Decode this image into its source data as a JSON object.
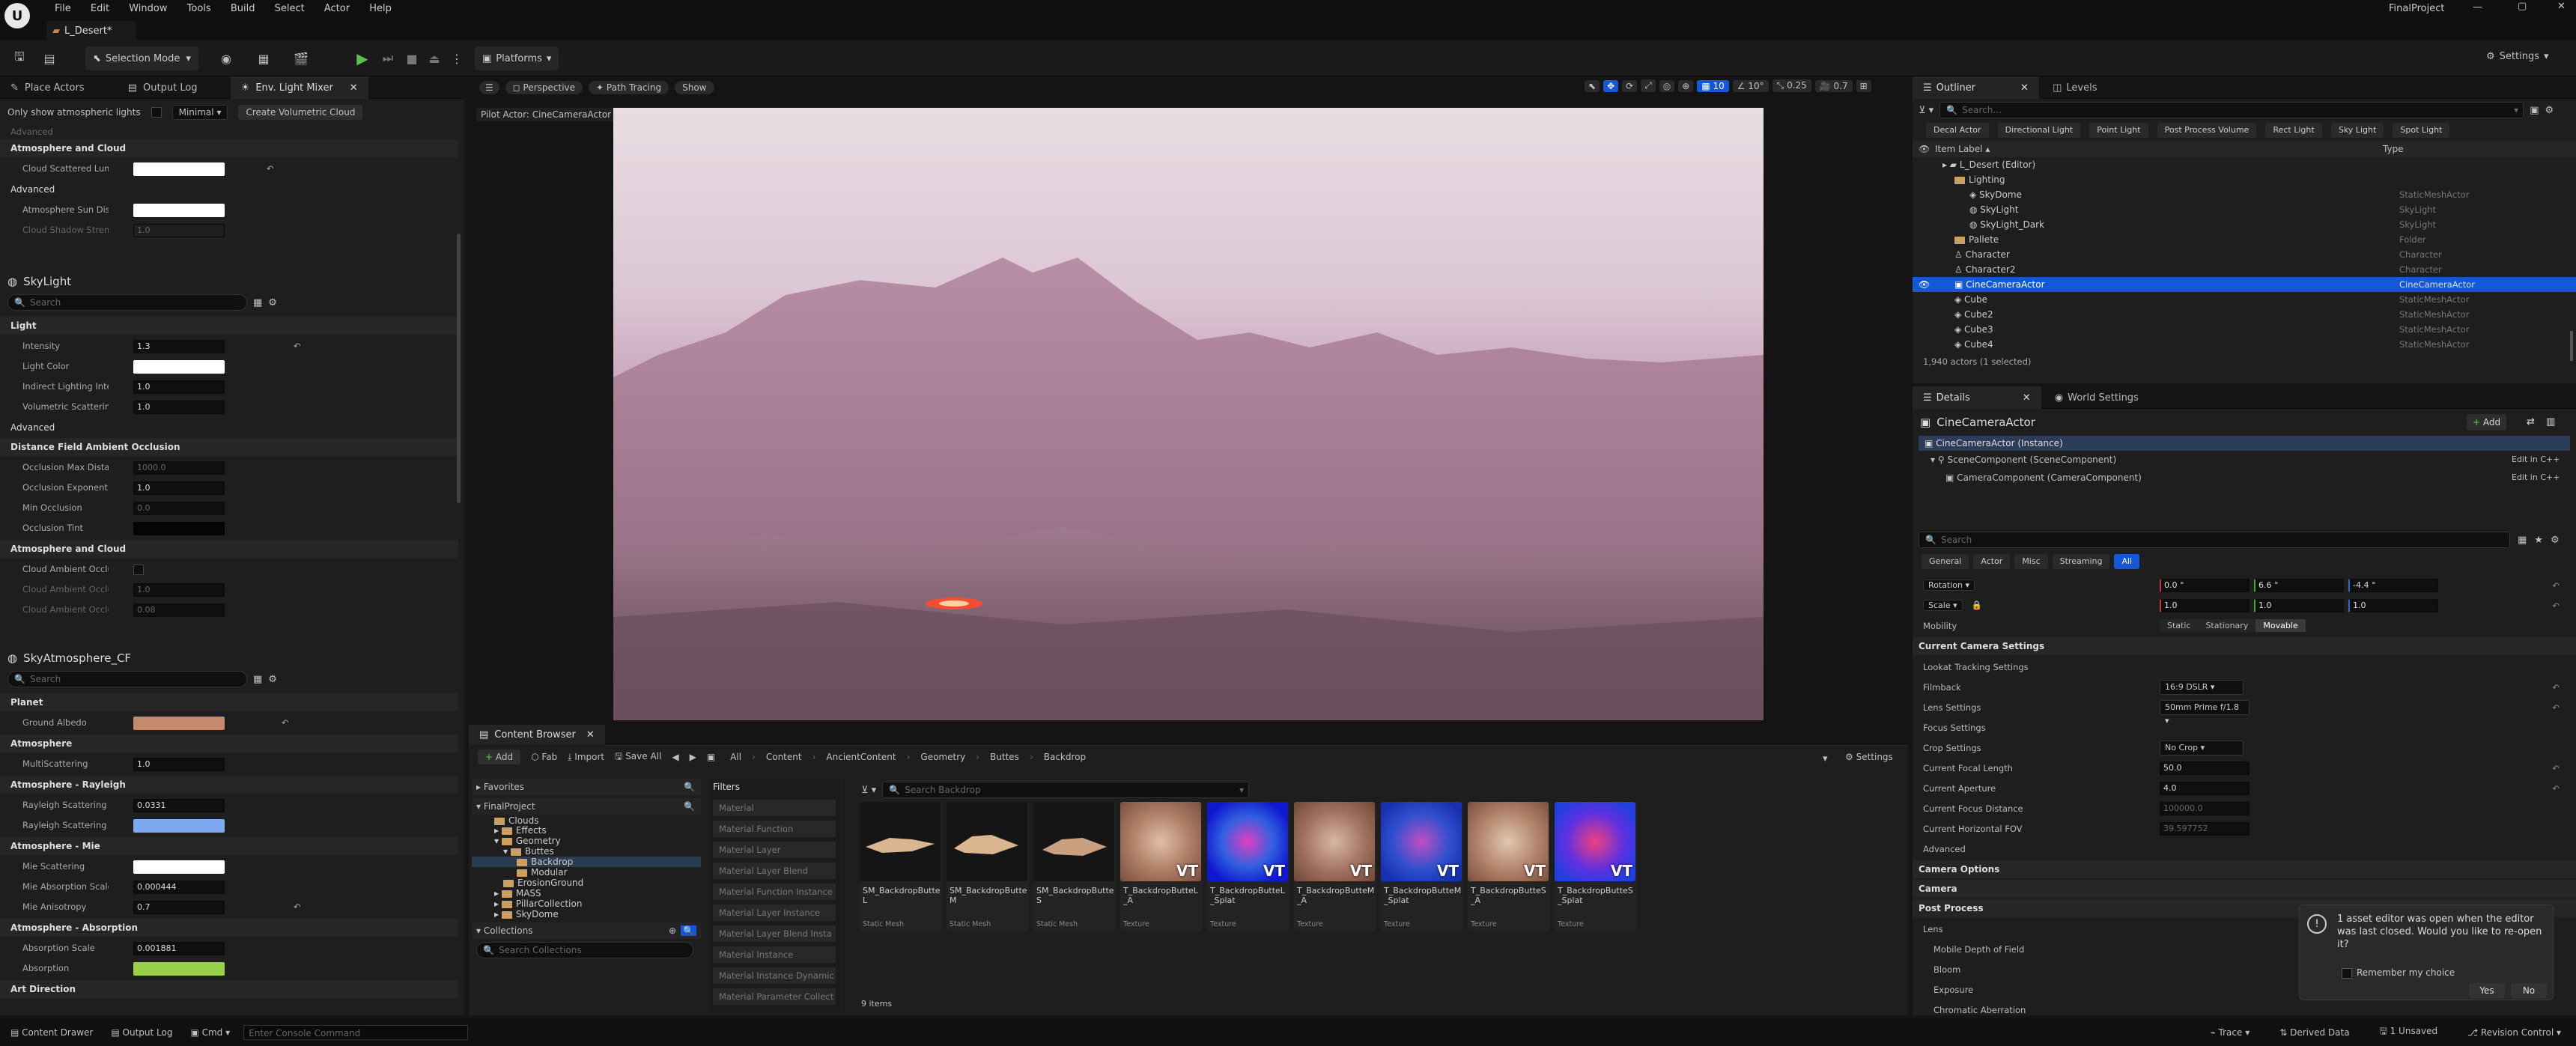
{
  "menu": [
    "File",
    "Edit",
    "Window",
    "Tools",
    "Build",
    "Select",
    "Actor",
    "Help"
  ],
  "project_name": "FinalProject",
  "level_tab": "L_Desert*",
  "toolbar": {
    "mode": "Selection Mode",
    "platforms": "Platforms",
    "settings": "Settings"
  },
  "left_tabs": [
    "Place Actors",
    "Output Log",
    "Env. Light Mixer"
  ],
  "left_filter": {
    "only_atmospheric": "Only show atmospheric lights",
    "minimal": "Minimal",
    "create_cloud": "Create Volumetric Cloud"
  },
  "left_sections_top": {
    "advanced_hdr": "Advanced",
    "atmo_cloud_hdr": "Atmosphere and Cloud",
    "cloud_scattered": "Cloud Scattered Lumi...",
    "advanced2_hdr": "Advanced",
    "atmo_sun_disk": "Atmosphere Sun Disk...",
    "cloud_shadow": "Cloud Shadow Strength",
    "cloud_shadow_val": "1.0"
  },
  "skylight": {
    "title": "SkyLight",
    "search": "Search",
    "light_hdr": "Light",
    "intensity": "Intensity",
    "intensity_val": "1.3",
    "light_color": "Light Color",
    "indirect": "Indirect Lighting Intensity",
    "indirect_val": "1.0",
    "volumetric": "Volumetric Scattering In...",
    "volumetric_val": "1.0",
    "advanced_hdr": "Advanced",
    "dfao_hdr": "Distance Field Ambient Occlusion",
    "occ_max": "Occlusion Max Distance",
    "occ_max_val": "1000.0",
    "occ_exp": "Occlusion Exponent",
    "occ_exp_val": "1.0",
    "min_occ": "Min Occlusion",
    "min_occ_val": "0.0",
    "occ_tint": "Occlusion Tint",
    "atmo_cloud_hdr": "Atmosphere and Cloud",
    "cloud_amb": "Cloud Ambient Occlusion",
    "cloud_amb2": "Cloud Ambient Occlusio...",
    "cloud_amb2_val": "1.0",
    "cloud_amb3": "Cloud Ambient Occlusio...",
    "cloud_amb3_val": "0.08"
  },
  "skyatmo": {
    "title": "SkyAtmosphere_CF",
    "search": "Search",
    "planet_hdr": "Planet",
    "ground_albedo": "Ground Albedo",
    "atmosphere_hdr": "Atmosphere",
    "multiscattering": "MultiScattering",
    "multiscattering_val": "1.0",
    "rayleigh_hdr": "Atmosphere - Rayleigh",
    "ray_scale": "Rayleigh Scattering Scale",
    "ray_scale_val": "0.0331",
    "ray_scat": "Rayleigh Scattering",
    "mie_hdr": "Atmosphere - Mie",
    "mie_scat": "Mie Scattering",
    "mie_abs": "Mie Absorption Scale",
    "mie_abs_val": "0.000444",
    "mie_aniso": "Mie Anisotropy",
    "mie_aniso_val": "0.7",
    "abs_hdr": "Atmosphere - Absorption",
    "abs_scale": "Absorption Scale",
    "abs_scale_val": "0.001881",
    "absorption": "Absorption",
    "art_hdr": "Art Direction"
  },
  "viewport": {
    "perspective": "Perspective",
    "path_tracing": "Path Tracing",
    "show": "Show",
    "pilot": "Pilot Actor: CineCameraActor",
    "grid": "10",
    "angle": "10°",
    "scale": "0.25",
    "cam": "0.7"
  },
  "content_browser": {
    "title": "Content Browser",
    "add": "Add",
    "fab": "Fab",
    "import": "Import",
    "save_all": "Save All",
    "path": [
      "All",
      "Content",
      "AncientContent",
      "Geometry",
      "Buttes",
      "Backdrop"
    ],
    "settings": "Settings",
    "favorites": "Favorites",
    "project": "FinalProject",
    "tree": [
      "Clouds",
      "Effects",
      "Geometry",
      "Buttes",
      "Backdrop",
      "Modular",
      "ErosionGround",
      "MASS",
      "PillarCollection",
      "SkyDome"
    ],
    "collections": "Collections",
    "search_collections": "Search Collections",
    "filters_title": "Filters",
    "filters": [
      "Material",
      "Material Function",
      "Material Layer",
      "Material Layer Blend",
      "Material Function Instance",
      "Material Layer Instance",
      "Material Layer Blend Insta",
      "Material Instance",
      "Material Instance Dynamic",
      "Material Parameter Collect"
    ],
    "search": "Search Backdrop",
    "items": [
      {
        "name": "SM_BackdropButteL",
        "type": "Static Mesh"
      },
      {
        "name": "SM_BackdropButteM",
        "type": "Static Mesh"
      },
      {
        "name": "SM_BackdropButteS",
        "type": "Static Mesh"
      },
      {
        "name": "T_BackdropButteL_A",
        "type": "Texture"
      },
      {
        "name": "T_BackdropButteL_Splat",
        "type": "Texture"
      },
      {
        "name": "T_BackdropButteM_A",
        "type": "Texture"
      },
      {
        "name": "T_BackdropButteM_Splat",
        "type": "Texture"
      },
      {
        "name": "T_BackdropButteS_A",
        "type": "Texture"
      },
      {
        "name": "T_BackdropButteS_Splat",
        "type": "Texture"
      }
    ],
    "count": "9 items"
  },
  "outliner": {
    "tabs": [
      "Outliner",
      "Levels"
    ],
    "search": "Search...",
    "chips": [
      "Decal Actor",
      "Directional Light",
      "Point Light",
      "Post Process Volume",
      "Rect Light",
      "Sky Light",
      "Spot Light"
    ],
    "col_label": "Item Label",
    "col_type": "Type",
    "rows": [
      {
        "name": "L_Desert (Editor)",
        "type": ""
      },
      {
        "name": "Lighting",
        "type": ""
      },
      {
        "name": "SkyDome",
        "type": "StaticMeshActor"
      },
      {
        "name": "SkyLight",
        "type": "SkyLight"
      },
      {
        "name": "SkyLight_Dark",
        "type": "SkyLight"
      },
      {
        "name": "Pallete",
        "type": "Folder"
      },
      {
        "name": "Character",
        "type": "Character"
      },
      {
        "name": "Character2",
        "type": "Character"
      },
      {
        "name": "CineCameraActor",
        "type": "CineCameraActor"
      },
      {
        "name": "Cube",
        "type": "StaticMeshActor"
      },
      {
        "name": "Cube2",
        "type": "StaticMeshActor"
      },
      {
        "name": "Cube3",
        "type": "StaticMeshActor"
      },
      {
        "name": "Cube4",
        "type": "StaticMeshActor"
      }
    ],
    "count": "1,940 actors (1 selected)"
  },
  "details": {
    "tabs": [
      "Details",
      "World Settings"
    ],
    "actor": "CineCameraActor",
    "add": "Add",
    "instance": "CineCameraActor (Instance)",
    "scene_comp": "SceneComponent (SceneComponent)",
    "camera_comp": "CameraComponent (CameraComponent)",
    "edit_cpp": "Edit in C++",
    "search": "Search",
    "filter_tabs": [
      "General",
      "Actor",
      "Misc",
      "Streaming",
      "All"
    ],
    "rotation": "Rotation",
    "rot": [
      "0.0 °",
      "6.6 °",
      "-4.4 °"
    ],
    "scale": "Scale",
    "scl": [
      "1.0",
      "1.0",
      "1.0"
    ],
    "mobility": "Mobility",
    "mobility_opts": [
      "Static",
      "Stationary",
      "Movable"
    ],
    "current_camera": "Current Camera Settings",
    "lookat": "Lookat Tracking Settings",
    "filmback": "Filmback",
    "filmback_val": "16:9 DSLR",
    "lens": "Lens Settings",
    "lens_val": "50mm Prime f/1.8",
    "focus": "Focus Settings",
    "crop": "Crop Settings",
    "crop_val": "No Crop",
    "focal": "Current Focal Length",
    "focal_val": "50.0",
    "aperture": "Current Aperture",
    "aperture_val": "4.0",
    "focus_dist": "Current Focus Distance",
    "focus_dist_val": "100000.0",
    "fov": "Current Horizontal FOV",
    "fov_val": "39.597752",
    "advanced": "Advanced",
    "camera_options": "Camera Options",
    "camera": "Camera",
    "post_process": "Post Process",
    "lens_pp": "Lens",
    "mobile_dof": "Mobile Depth of Field",
    "bloom": "Bloom",
    "exposure": "Exposure",
    "chromatic": "Chromatic Aberration"
  },
  "notification": {
    "text": "1 asset editor was open when the editor was last closed. Would you like to re-open it?",
    "remember": "Remember my choice",
    "yes": "Yes",
    "no": "No"
  },
  "statusbar": {
    "content_drawer": "Content Drawer",
    "output_log": "Output Log",
    "cmd": "Cmd",
    "console": "Enter Console Command",
    "trace": "Trace",
    "derived": "Derived Data",
    "unsaved": "1 Unsaved",
    "revision": "Revision Control"
  },
  "colors": {
    "accent": "#1458d8",
    "ground_albedo": "#c48a6b",
    "rayleigh": "#7ea8f0",
    "absorption": "#98d04a"
  }
}
